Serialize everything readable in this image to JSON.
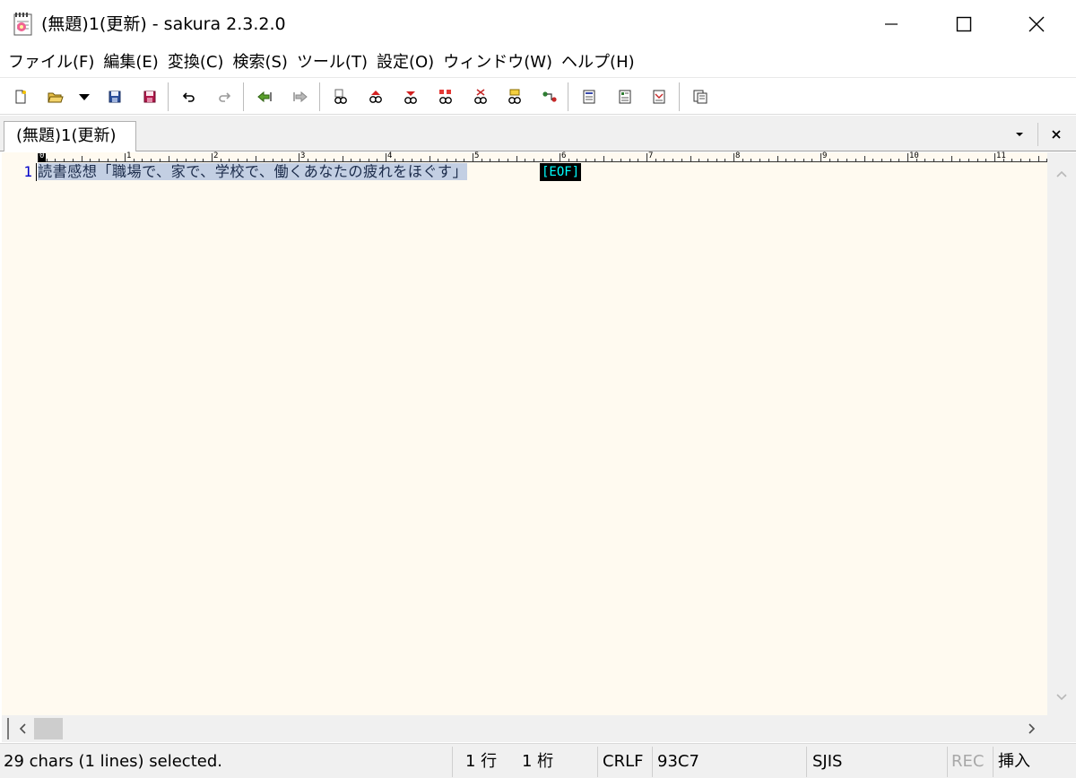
{
  "window": {
    "title": "(無題)1(更新) - sakura 2.3.2.0"
  },
  "menu": [
    "ファイル(F)",
    "編集(E)",
    "変換(C)",
    "検索(S)",
    "ツール(T)",
    "設定(O)",
    "ウィンドウ(W)",
    "ヘルプ(H)"
  ],
  "toolbar": {
    "buttons": [
      "new-file-icon",
      "open-folder-icon",
      "dropdown-arrow-icon",
      "save-icon",
      "save-all-icon",
      "undo-icon",
      "redo-icon",
      "jump-back-icon",
      "jump-forward-icon",
      "find-icon",
      "find-prev-icon",
      "find-next-icon",
      "replace-icon",
      "grep-icon",
      "grep-replace-icon",
      "tag-jump-icon",
      "outline-icon",
      "view-mode-icon",
      "compare-icon",
      "settings-panel-icon"
    ]
  },
  "tabs": {
    "active_label": "(無題)1(更新)"
  },
  "editor": {
    "line_number": "1",
    "line_text": "読書感想「職場で、家で、学校で、働くあなたの疲れをほぐす」",
    "eof": "[EOF]",
    "ruler_numbers": [
      "0",
      "1",
      "2",
      "3",
      "4",
      "5",
      "6",
      "7",
      "8",
      "9",
      "10",
      "11"
    ],
    "background": "#fffaf0",
    "selection_color": "#c3cfe3"
  },
  "status": {
    "message": "29 chars (1 lines) selected.",
    "line": "1 行",
    "column": "1 桁",
    "newline": "CRLF",
    "char_code": "93C7",
    "encoding": "SJIS",
    "rec": "REC",
    "mode": "挿入"
  }
}
